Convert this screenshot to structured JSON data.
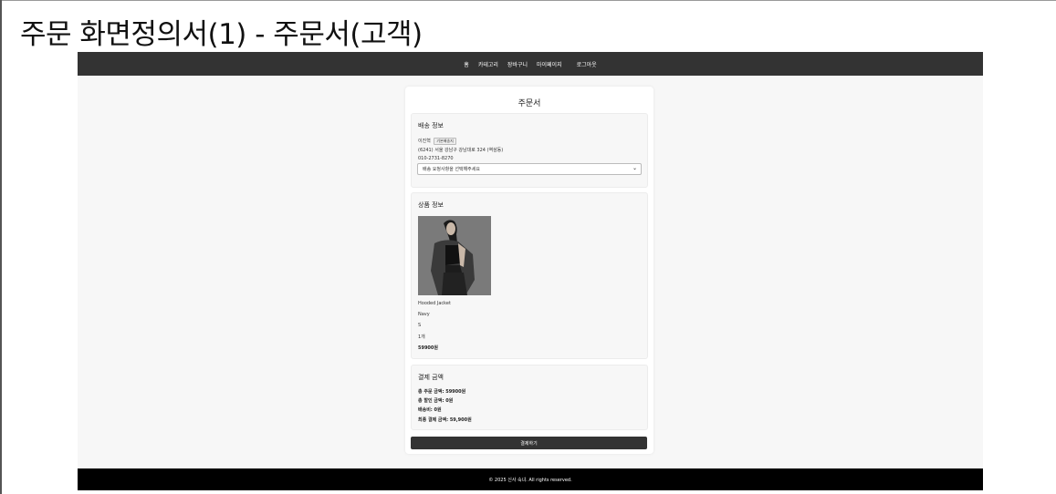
{
  "slide": {
    "title": "주문 화면정의서(1) - 주문서(고객)"
  },
  "nav": {
    "items": [
      "홈",
      "카테고리",
      "장바구니",
      "마이페이지",
      "로그아웃"
    ]
  },
  "order": {
    "title": "주문서",
    "shipping": {
      "heading": "배송 정보",
      "name": "이진혁",
      "default_badge": "기본배송지",
      "address": "(6241) 서울 강남구 강남대로 324 (역삼동)",
      "phone": "010-2731-8270",
      "request_placeholder": "배송 요청사항을 선택해주세요"
    },
    "product": {
      "heading": "상품 정보",
      "name": "Hooded Jacket",
      "color": "Navy",
      "size": "S",
      "quantity": "1개",
      "price": "59900원"
    },
    "payment": {
      "heading": "결제 금액",
      "total_order": "총 주문 금액: 59900원",
      "total_discount": "총 할인 금액: 0원",
      "shipping_fee": "배송비: 0원",
      "final_payment": "최종 결제 금액: 59,900원"
    },
    "pay_button": "결제하기"
  },
  "footer": {
    "text": "© 2025 신사 숙녀. All rights reserved."
  }
}
